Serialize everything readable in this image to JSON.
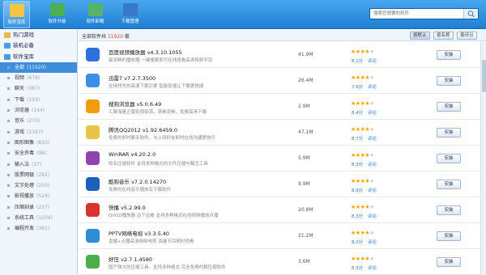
{
  "toolbar": {
    "buttons": [
      {
        "label": "软件宝库",
        "icon": "software-library-icon",
        "color": "#f5c542"
      },
      {
        "label": "软件升级",
        "icon": "upgrade-icon",
        "color": "#4caf50"
      },
      {
        "label": "软件卸载",
        "icon": "uninstall-icon",
        "color": "#58b368"
      },
      {
        "label": "下载管理",
        "icon": "download-manager-icon",
        "color": "#3a78c9"
      }
    ],
    "search_placeholder": "搜索您想要的软件"
  },
  "sidebar": {
    "top_items": [
      {
        "label": "热门游戏",
        "icon": "hot-games-icon",
        "color": "#e8b84a"
      },
      {
        "label": "装机必备",
        "icon": "essentials-icon",
        "color": "#4a9be8"
      },
      {
        "label": "软件宝库",
        "icon": "library-icon",
        "color": "#4a9be8"
      }
    ],
    "categories": [
      {
        "label": "全部",
        "count": "(11920)"
      },
      {
        "label": "视频",
        "count": "(678)"
      },
      {
        "label": "聊天",
        "count": "(387)"
      },
      {
        "label": "下载",
        "count": "(193)"
      },
      {
        "label": "浏览器",
        "count": "(144)"
      },
      {
        "label": "音乐",
        "count": "(270)"
      },
      {
        "label": "游戏",
        "count": "(1167)"
      },
      {
        "label": "图形图像",
        "count": "(810)"
      },
      {
        "label": "安全杀毒",
        "count": "(98)"
      },
      {
        "label": "输入法",
        "count": "(37)"
      },
      {
        "label": "股票网银",
        "count": "(282)"
      },
      {
        "label": "文字处理",
        "count": "(259)"
      },
      {
        "label": "影视播放",
        "count": "(524)"
      },
      {
        "label": "压缩刻录",
        "count": "(237)"
      },
      {
        "label": "系统工具",
        "count": "(1204)"
      },
      {
        "label": "编程开发",
        "count": "(365)"
      }
    ]
  },
  "list": {
    "count_prefix": "全部软件共",
    "count_value": "11920",
    "count_suffix": "套",
    "sort_buttons": [
      "按默认",
      "按名称",
      "按评分"
    ],
    "install_label": "安装",
    "review_label": "评论",
    "apps": [
      {
        "name": "百度视频播放器 v4.3.10.1055",
        "desc": "最流畅的播放器 一键搜索即可在线观看高清视频节目",
        "size": "41.9M",
        "score": "8.1分",
        "stars": 4,
        "icon": "baidu-video-icon",
        "color": "#2f6fdc"
      },
      {
        "name": "迅雷7 v7.2.7.3500",
        "desc": "全球领先的高速下载引擎 智能加速让下载更快捷",
        "size": "26.4M",
        "score": "7.6分",
        "stars": 4,
        "icon": "xunlei-icon",
        "color": "#3a8ee6"
      },
      {
        "name": "搜狗浏览器 v5.0.6.49",
        "desc": "汇聚海量正版影视资源，清晰流畅，免费高清下载",
        "size": "2.9M",
        "score": "8.4分",
        "stars": 4,
        "icon": "sogou-browser-icon",
        "color": "#f39c12"
      },
      {
        "name": "腾讯QQ2012 v1.92.6459.0",
        "desc": "免费的即时聊天软件，与上网好友即时在线沟通更快乐",
        "size": "47.1M",
        "score": "8.7分",
        "stars": 4,
        "icon": "qq-icon",
        "color": "#e8c547"
      },
      {
        "name": "WinRAR v4.20.2.0",
        "desc": "知名压缩软件 支持多种格式的文件压缩与解压工具",
        "size": "5.9M",
        "score": "8.3分",
        "stars": 4,
        "icon": "winrar-icon",
        "color": "#8e44ad"
      },
      {
        "name": "酷狗音乐 v7.2.0.14270",
        "desc": "免费的在线音乐播放及下载软件",
        "size": "9.9M",
        "score": "8.6分",
        "stars": 4,
        "icon": "kugou-icon",
        "color": "#1f5fbf"
      },
      {
        "name": "快播 v5.2.99.0",
        "desc": "QVOD播放器 边下边看 支持多种格式在线视频播放点播",
        "size": "20.8M",
        "score": "8.3分",
        "stars": 4,
        "icon": "qvod-icon",
        "color": "#d8342c"
      },
      {
        "name": "PPTV网络电视 v3.3.5.40",
        "desc": "直播+点播高清网络电视 海量节目随时观看",
        "size": "21.2M",
        "score": "8.0分",
        "stars": 4,
        "icon": "pptv-icon",
        "color": "#2d8ed8"
      },
      {
        "name": "好压 v2.7.1.4580",
        "desc": "国产强大的压缩工具，支持多种格式 完全免费的解压缩软件",
        "size": "3.6M",
        "score": "8.5分",
        "stars": 4,
        "icon": "haozip-icon",
        "color": "#4cae4c"
      }
    ]
  }
}
